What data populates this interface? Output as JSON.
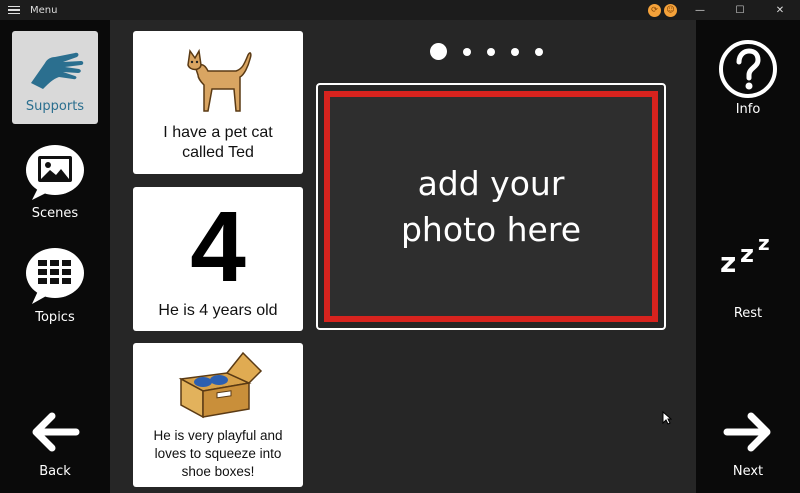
{
  "titlebar": {
    "menu_label": "Menu",
    "minimize_glyph": "—",
    "maximize_glyph": "☐",
    "close_glyph": "✕"
  },
  "left_sidebar": {
    "items": [
      {
        "label": "Supports",
        "icon": "hand-icon",
        "selected": true
      },
      {
        "label": "Scenes",
        "icon": "picture-bubble-icon",
        "selected": false
      },
      {
        "label": "Topics",
        "icon": "grid-bubble-icon",
        "selected": false
      },
      {
        "label": "Back",
        "icon": "arrow-left-icon",
        "selected": false
      }
    ]
  },
  "right_sidebar": {
    "items": [
      {
        "label": "Info",
        "icon": "question-icon"
      },
      {
        "label": "Rest",
        "icon": "zzz-icon"
      },
      {
        "label": "Next",
        "icon": "arrow-right-icon"
      }
    ]
  },
  "cards": [
    {
      "caption": "I have a pet cat called Ted",
      "icon": "cat-icon"
    },
    {
      "caption": "He is 4 years old",
      "number": "4"
    },
    {
      "caption": "He is very playful and loves to squeeze into shoe boxes!",
      "icon": "shoe-box-icon"
    }
  ],
  "pager": {
    "count": 5,
    "active_index": 0
  },
  "photo_placeholder": {
    "text": "add your\nphoto here"
  },
  "colors": {
    "photo_border": "#d8231e",
    "supports_label": "#2b6f8f",
    "title_badge": "#f5a23a"
  }
}
